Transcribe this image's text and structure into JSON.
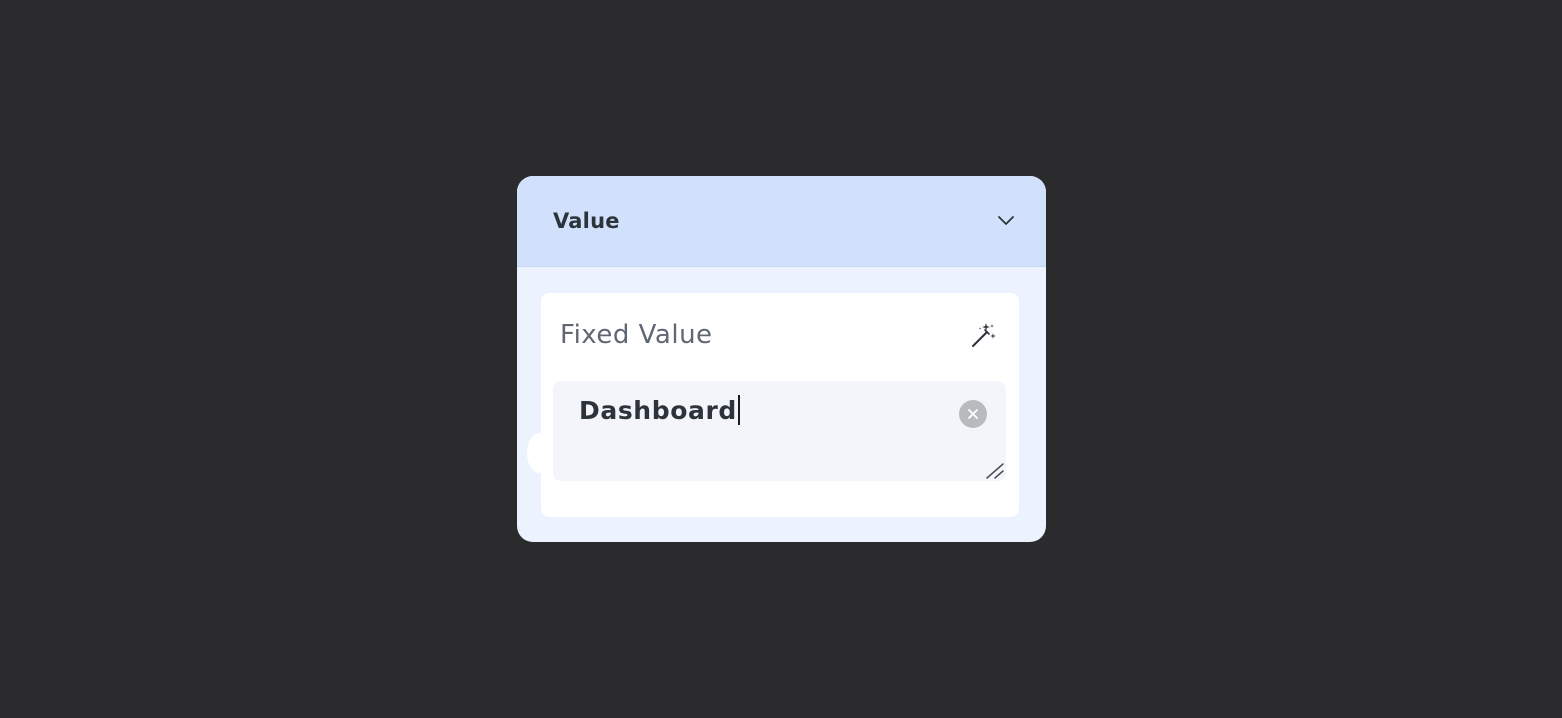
{
  "panel": {
    "title": "Value",
    "toggle_icon": "chevron-down-icon"
  },
  "card": {
    "label": "Fixed Value",
    "action_icon": "magic-wand-icon",
    "field": {
      "value": "Dashboard",
      "clear_icon": "clear-icon",
      "resize_icon": "resize-handle-icon"
    }
  },
  "colors": {
    "background": "#2b2b2d",
    "panel_header": "#d1e1fb",
    "panel_body": "#ecf3fe",
    "card": "#ffffff",
    "field": "#f3f5fa"
  }
}
